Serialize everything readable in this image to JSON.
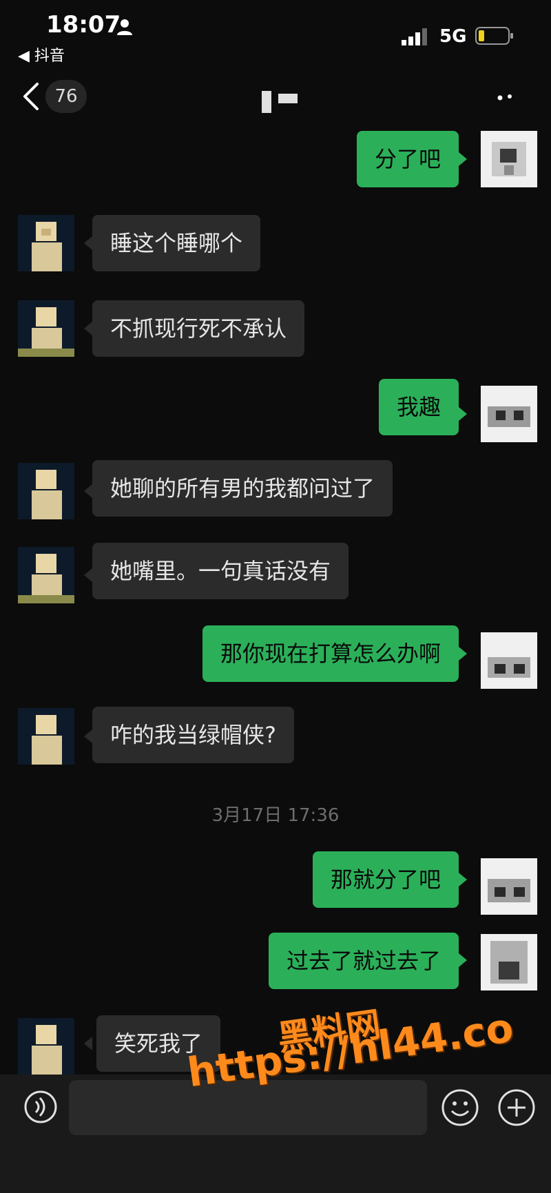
{
  "status_bar": {
    "time": "18:07",
    "back_app": "◀ 抖音",
    "network": "5G"
  },
  "header": {
    "unread_count": "76",
    "title_masked": true
  },
  "messages": [
    {
      "from": "me",
      "text": "分了吧"
    },
    {
      "from": "other",
      "text": "睡这个睡哪个"
    },
    {
      "from": "other",
      "text": "不抓现行死不承认"
    },
    {
      "from": "me",
      "text": "我趣"
    },
    {
      "from": "other",
      "text": "她聊的所有男的我都问过了"
    },
    {
      "from": "other",
      "text": "她嘴里。一句真话没有"
    },
    {
      "from": "me",
      "text": "那你现在打算怎么办啊"
    },
    {
      "from": "other",
      "text": "咋的我当绿帽侠?"
    },
    {
      "from": "me",
      "text": "那就分了吧"
    },
    {
      "from": "me",
      "text": "过去了就过去了"
    },
    {
      "from": "other",
      "text": "笑死我了"
    }
  ],
  "timestamp": "3月17日 17:36",
  "input": {
    "value": "",
    "placeholder": ""
  },
  "watermark": {
    "line1": "黑料网",
    "line2": "https://hl44.co"
  },
  "colors": {
    "background": "#0c0c0c",
    "outgoing_bubble": "#2bb059",
    "incoming_bubble": "#2b2b2b",
    "watermark": "#ff8a1c"
  }
}
